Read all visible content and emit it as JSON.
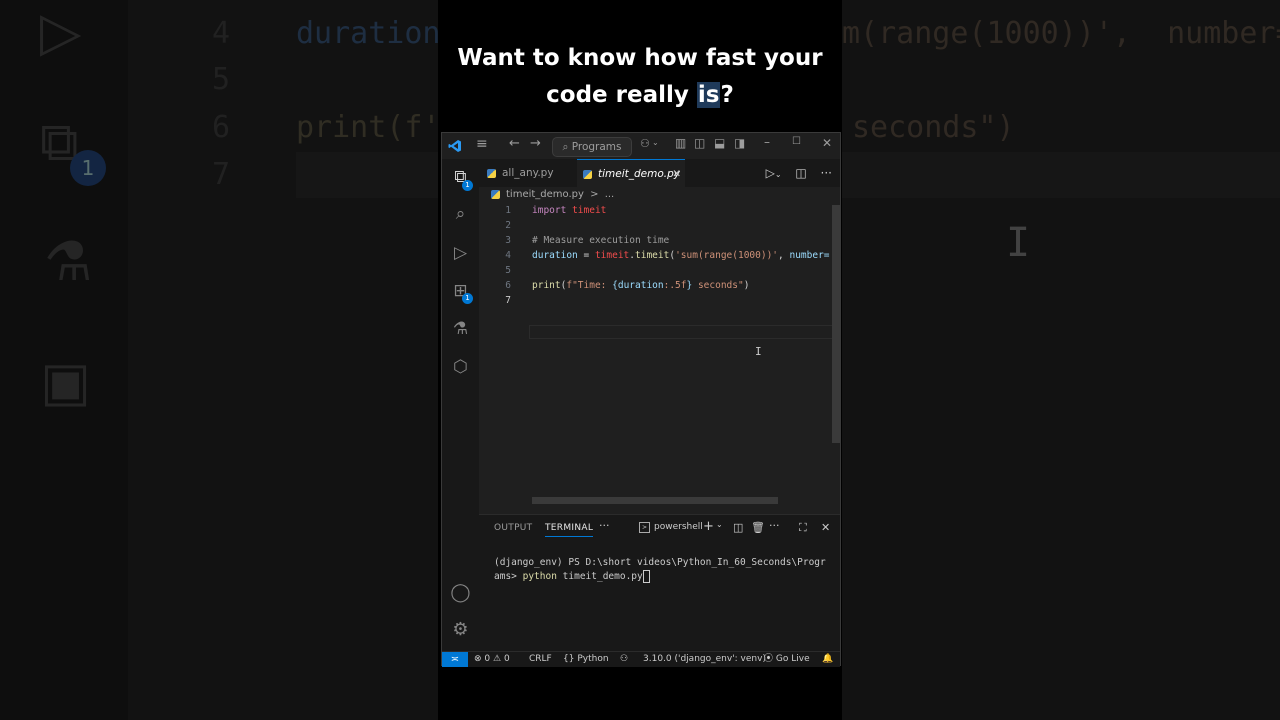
{
  "caption": {
    "line1": "Want to know how fast your",
    "line2_pre": "code really ",
    "line2_hl": "is",
    "line2_post": "?"
  },
  "background": {
    "lines": [
      {
        "num": "4",
        "text": "duration",
        "text2": "m(range(1000))',  number="
      },
      {
        "num": "5",
        "text": ""
      },
      {
        "num": "6",
        "text": "print(f'",
        "text2": "seconds\")"
      },
      {
        "num": "7",
        "text": ""
      }
    ],
    "badge": "1"
  },
  "titlebar": {
    "search": "Programs"
  },
  "activity_bar": {
    "explorer_badge": "1",
    "extensions_badge": "1"
  },
  "tabs": [
    {
      "label": "all_any.py",
      "active": false
    },
    {
      "label": "timeit_demo.py",
      "active": true,
      "close": "✕"
    }
  ],
  "breadcrumb": {
    "file": "timeit_demo.py",
    "sep": ">",
    "more": "..."
  },
  "code": {
    "line_numbers": [
      "1",
      "2",
      "3",
      "4",
      "5",
      "6",
      "7"
    ],
    "l1_kw": "import",
    "l1_mod": "timeit",
    "l3": "# Measure execution time",
    "l4_var": "duration",
    "l4_eq": " = ",
    "l4_mod": "timeit",
    "l4_dot": ".",
    "l4_fn": "timeit",
    "l4_p1": "(",
    "l4_str": "'sum(range(1000))'",
    "l4_rest": ", ",
    "l4_var2": "number=",
    "l6_fn": "print",
    "l6_p": "(",
    "l6_str1": "f\"Time: ",
    "l6_brace": "{",
    "l6_var": "duration",
    "l6_fmt": ":.5f",
    "l6_brace2": "}",
    "l6_str2": " seconds\"",
    "l6_end": ")"
  },
  "panel": {
    "tabs": [
      "OUTPUT",
      "TERMINAL"
    ],
    "more": "···",
    "shell": "powershell",
    "terminal_prompt": "(django_env) PS D:\\short videos\\Python_In_60_Seconds\\Progr",
    "terminal_prompt2": "ams> ",
    "terminal_cmd": "python",
    "terminal_arg": " timeit_demo.py"
  },
  "statusbar": {
    "errors": "0",
    "warnings": "0",
    "eol": "CRLF",
    "language": "Python",
    "interpreter": "3.10.0 ('django_env': venv)",
    "golive": "Go Live"
  }
}
